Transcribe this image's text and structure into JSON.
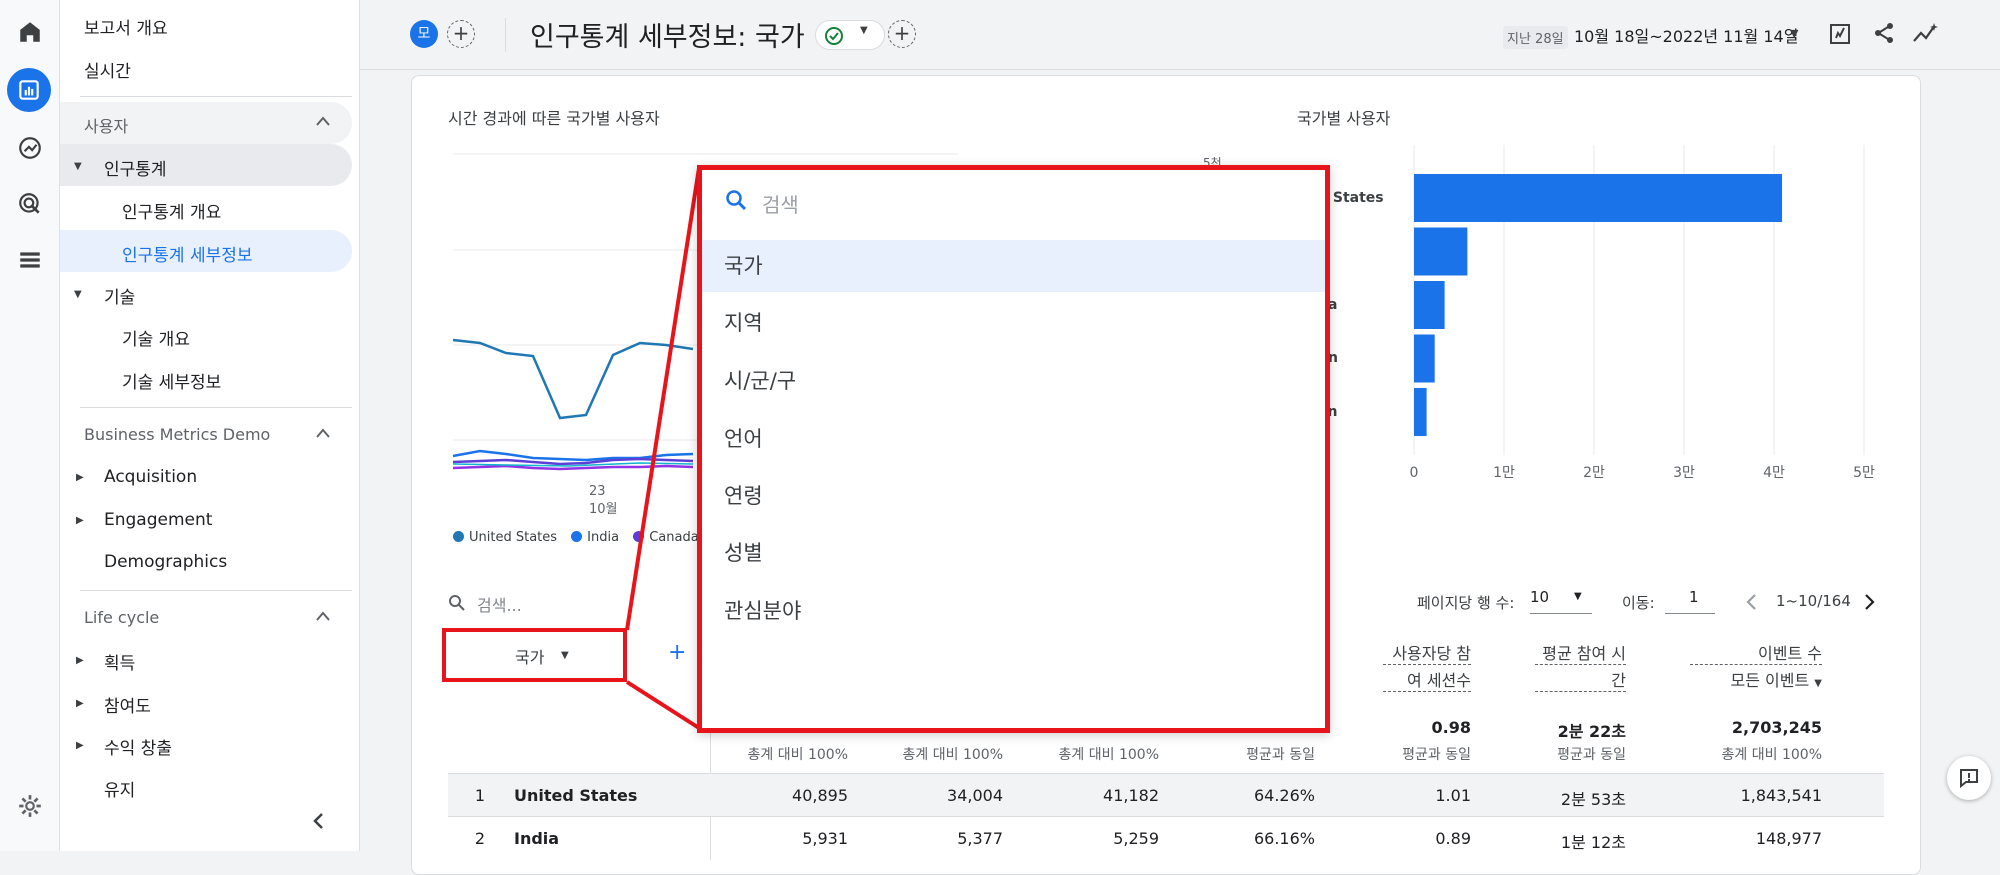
{
  "colors": {
    "accent": "#1a73e8",
    "highlight": "#e8141b",
    "bar": "#1a73e8"
  },
  "sidebar": {
    "top_items": [
      "보고서 개요",
      "실시간"
    ],
    "users_header": "사용자",
    "demographics": "인구통계",
    "demographics_overview": "인구통계 개요",
    "demographics_details": "인구통계 세부정보",
    "tech": "기술",
    "tech_overview": "기술 개요",
    "tech_details": "기술 세부정보",
    "bmd_header": "Business Metrics Demo",
    "acquisition": "Acquisition",
    "engagement": "Engagement",
    "demographics_en": "Demographics",
    "lifecycle_header": "Life cycle",
    "lc_acquisition": "획득",
    "lc_engagement": "참여도",
    "lc_monetization": "수익 창출",
    "lc_retention": "유지"
  },
  "header": {
    "badge": "모",
    "title": "인구통계 세부정보: 국가",
    "date_prefix": "지난 28일",
    "date_range": "10월 18일~2022년 11월 14일"
  },
  "line_chart": {
    "title": "시간 경과에 따른 국가별 사용자",
    "x_tick_day": "23",
    "x_tick_month": "10월",
    "legend": [
      "United States",
      "India",
      "Canada"
    ],
    "legend_colors": [
      "#1f77b4",
      "#1a73e8",
      "#5b3fd6"
    ],
    "y_tick_partial": "5천"
  },
  "bar_chart": {
    "title": "국가별 사용자",
    "label_fragments": [
      "d States",
      "da",
      "n",
      "an"
    ],
    "ticks": [
      "0",
      "1만",
      "2만",
      "3만",
      "4만",
      "5만"
    ]
  },
  "chart_data": {
    "type": "bar",
    "orientation": "horizontal",
    "title": "국가별 사용자",
    "categories": [
      "United States",
      "India",
      "Canada",
      "",
      ""
    ],
    "values": [
      40895,
      5931,
      3400,
      2300,
      1400
    ],
    "xlim": [
      0,
      50000
    ]
  },
  "toolbar": {
    "search_placeholder": "검색...",
    "rows_per_page_label": "페이지당 행 수:",
    "rows_per_page": "10",
    "goto_label": "이동:",
    "goto_value": "1",
    "pagination": "1~10/164"
  },
  "table": {
    "dimension_label": "국가",
    "col_sessions_per_user": [
      "사용자당 참",
      "여 세션수"
    ],
    "col_avg_engagement": [
      "평균 참여 시",
      "간"
    ],
    "col_events": [
      "이벤트 수",
      "모든 이벤트"
    ],
    "totals": [
      "",
      "",
      "",
      "",
      "0.98",
      "2분 22초",
      "2,703,245"
    ],
    "totals_sub": [
      "총계 대비 100%",
      "총계 대비 100%",
      "총계 대비 100%",
      "평균과 동일",
      "평균과 동일",
      "평균과 동일",
      "총계 대비 100%"
    ],
    "rows": [
      {
        "rank": "1",
        "country": "United States",
        "cells": [
          "40,895",
          "34,004",
          "41,182",
          "64.26%",
          "1.01",
          "2분 53초",
          "1,843,541"
        ]
      },
      {
        "rank": "2",
        "country": "India",
        "cells": [
          "5,931",
          "5,377",
          "5,259",
          "66.16%",
          "0.89",
          "1분 12초",
          "148,977"
        ]
      }
    ]
  },
  "popup": {
    "search_placeholder": "검색",
    "items": [
      "국가",
      "지역",
      "시/군/구",
      "언어",
      "연령",
      "성별",
      "관심분야"
    ],
    "selected_index": 0
  }
}
